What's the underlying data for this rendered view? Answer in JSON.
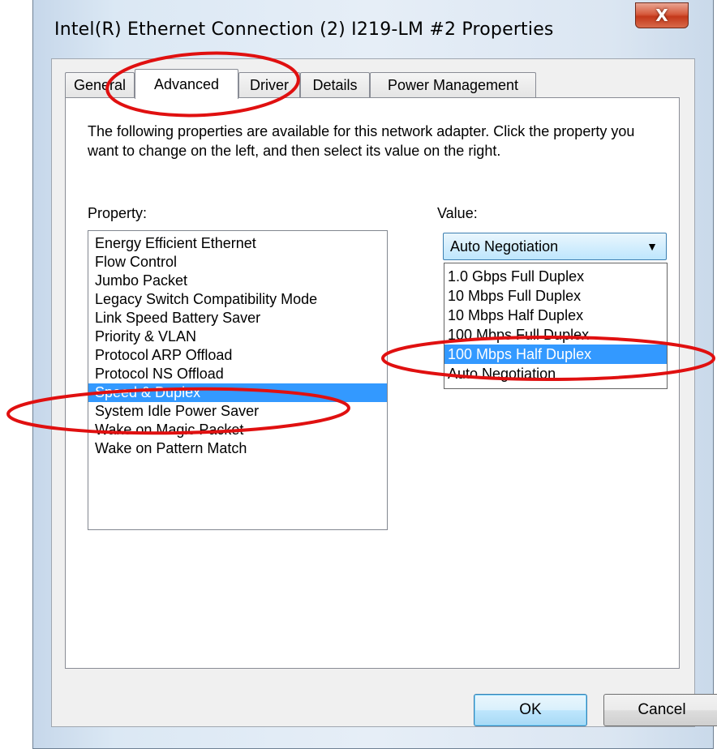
{
  "window": {
    "title": "Intel(R) Ethernet Connection (2) I219-LM #2 Properties",
    "close_glyph": "X"
  },
  "tabs": [
    {
      "label": "General"
    },
    {
      "label": "Advanced",
      "active": true
    },
    {
      "label": "Driver"
    },
    {
      "label": "Details"
    },
    {
      "label": "Power Management"
    }
  ],
  "advanced": {
    "description": "The following properties are available for this network adapter. Click the property you want to change on the left, and then select its value on the right.",
    "property_label": "Property:",
    "value_label": "Value:",
    "properties": [
      "Energy Efficient Ethernet",
      "Flow Control",
      "Jumbo Packet",
      "Legacy Switch Compatibility Mode",
      "Link Speed Battery Saver",
      "Priority & VLAN",
      "Protocol ARP Offload",
      "Protocol NS Offload",
      "Speed & Duplex",
      "System Idle Power Saver",
      "Wake on Magic Packet",
      "Wake on Pattern Match"
    ],
    "selected_property": "Speed & Duplex",
    "value_selected": "Auto Negotiation",
    "value_options": [
      "1.0 Gbps Full Duplex",
      "10 Mbps Full Duplex",
      "10 Mbps Half Duplex",
      "100 Mbps Full Duplex",
      "100 Mbps Half Duplex",
      "Auto Negotiation"
    ],
    "highlighted_option": "100 Mbps Half Duplex"
  },
  "buttons": {
    "ok": "OK",
    "cancel": "Cancel"
  },
  "colors": {
    "selection": "#3399ff",
    "annotation": "#e01010",
    "close_button": "#c9492a"
  }
}
